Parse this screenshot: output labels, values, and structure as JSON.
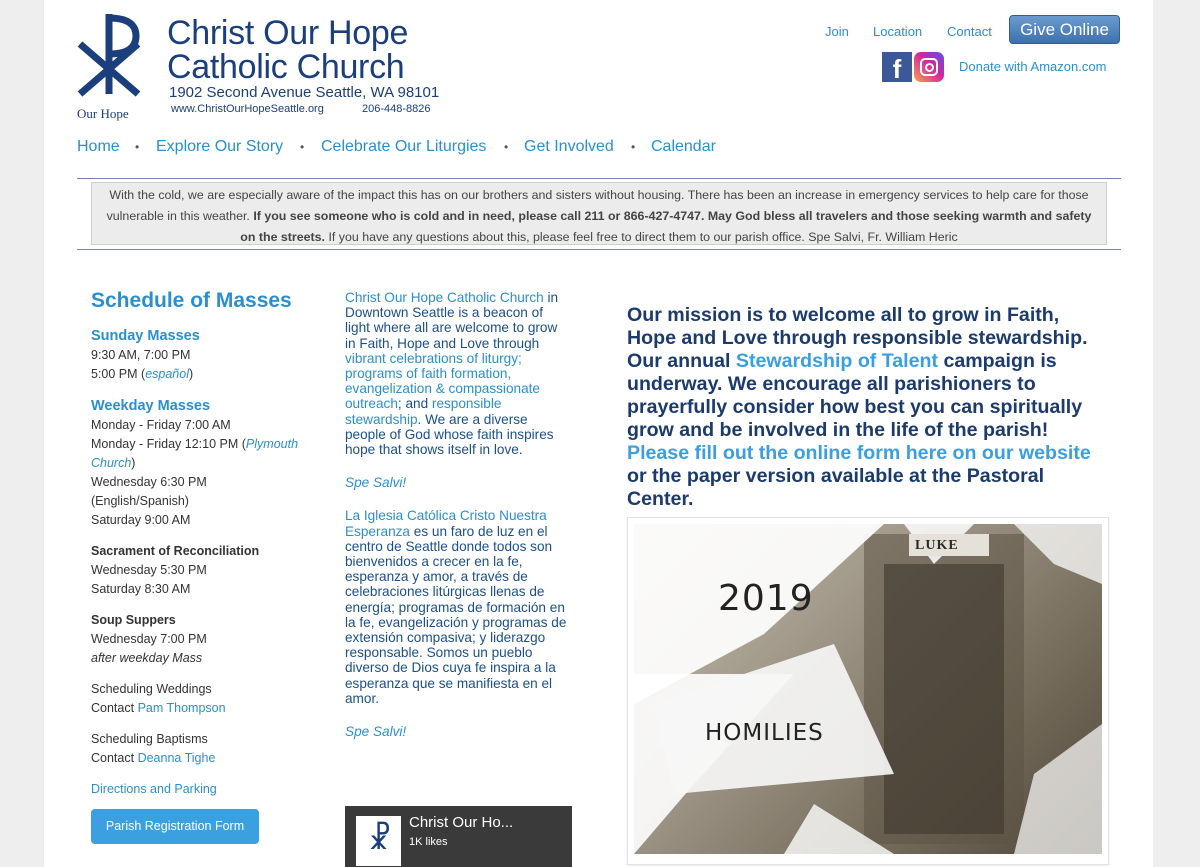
{
  "header": {
    "name_line1": "Christ Our Hope",
    "name_line2": "Catholic Church",
    "address": "1902 Second Avenue Seattle, WA 98101",
    "website": "www.ChristOurHopeSeattle.org",
    "phone": "206-448-8826",
    "logo_text": "Our Hope"
  },
  "toplinks": {
    "join": "Join",
    "location": "Location",
    "contact": "Contact",
    "give": "Give Online",
    "amazon": "Donate with Amazon.com"
  },
  "nav": [
    "Home",
    "Explore Our Story",
    "Celebrate Our Liturgies",
    "Get Involved",
    "Calendar"
  ],
  "notice": {
    "part1": "With the cold, we are especially aware of the impact this has on our brothers and sisters without housing. There has been an increase in emergency services to help care for those vulnerable in this weather. ",
    "bold": "If you see someone who is cold and in need, please call 211 or 866-427-4747. May God bless all travelers and those seeking warmth and safety on the streets.",
    "part2": " If you have any questions about this, please feel free to direct them to our parish office. Spe Salvi, Fr. William Heric"
  },
  "schedule": {
    "title": "Schedule of Masses",
    "sunday_heading": "Sunday Masses",
    "sunday_1": "9:30 AM, 7:00 PM",
    "sunday_2": "5:00 PM (",
    "sunday_espanol": "español",
    "sunday_2_end": ")",
    "weekday_heading": "Weekday Masses",
    "weekday_1": "Monday - Friday  7:00 AM",
    "weekday_2": "Monday - Friday  12:10 PM (",
    "weekday_plymouth": "Plymouth Church",
    "weekday_2_end": ")",
    "weekday_3": "Wednesday  6:30 PM",
    "weekday_4": "(English/Spanish)",
    "weekday_5": "Saturday  9:00 AM",
    "recon_heading": "Sacrament of Reconciliation",
    "recon_1": "Wednesday  5:30 PM",
    "recon_2": "Saturday  8:30 AM",
    "soup_heading": "Soup Suppers",
    "soup_1": "Wednesday 7:00 PM",
    "soup_2": "after weekday Mass",
    "weddings_1": "Scheduling Weddings",
    "weddings_2": "Contact ",
    "weddings_contact": "Pam Thompson",
    "baptisms_1": "Scheduling Baptisms",
    "baptisms_2": "Contact ",
    "baptisms_contact": "Deanna Tighe",
    "directions": "Directions and Parking",
    "registration": "Parish Registration Form"
  },
  "about": {
    "p1_link": "Christ Our Hope Catholic Church",
    "p1_a": " in Downtown Seattle is a beacon of light where all are welcome to grow in Faith, Hope and Love through ",
    "p1_link2": "vibrant celebrations of liturgy; programs of faith formation, evangelization & compassionate outreach",
    "p1_b": "; and ",
    "p1_link3": "responsible stewardship",
    "p1_c": ". We are a diverse people of God whose faith inspires hope that shows itself in love.",
    "spe": "Spe Salvi!",
    "p2_link": "La Iglesia Católica Cristo Nuestra Esperanza",
    "p2_text": " es un faro de luz en el centro de Seattle donde todos son bienvenidos a crecer en la fe, esperanza y amor, a través de celebraciones litúrgicas llenas de energía; programas de formación en la fe, evangelización y programas de extensión compasiva; y liderazgo responsable. Somos un pueblo diverso de Dios cuya fe inspira a la esperanza que se manifiesta en el amor.",
    "spe2": "Spe Salvi!"
  },
  "fb_widget": {
    "title": "Christ Our Ho...",
    "likes": "1K likes"
  },
  "mission": {
    "a": "Our mission is to welcome all to grow in Faith, Hope and Love through responsible stewardship. Our annual ",
    "link1": "Stewardship of Talent",
    "b": " campaign is underway. We encourage all parishioners to prayerfully consider how best you can spiritually grow and be involved in the life of the parish! ",
    "link2": "Please fill out the online form here on our website",
    "c": " or the paper version available at the Pastoral Center."
  },
  "promo": {
    "year": "2019",
    "title": "HOMILIES",
    "inscription": "LUKE"
  },
  "colors": {
    "brand_navy": "#1b3e7c",
    "link_blue": "#2a8fd0",
    "button_blue": "#3aa0e0"
  }
}
